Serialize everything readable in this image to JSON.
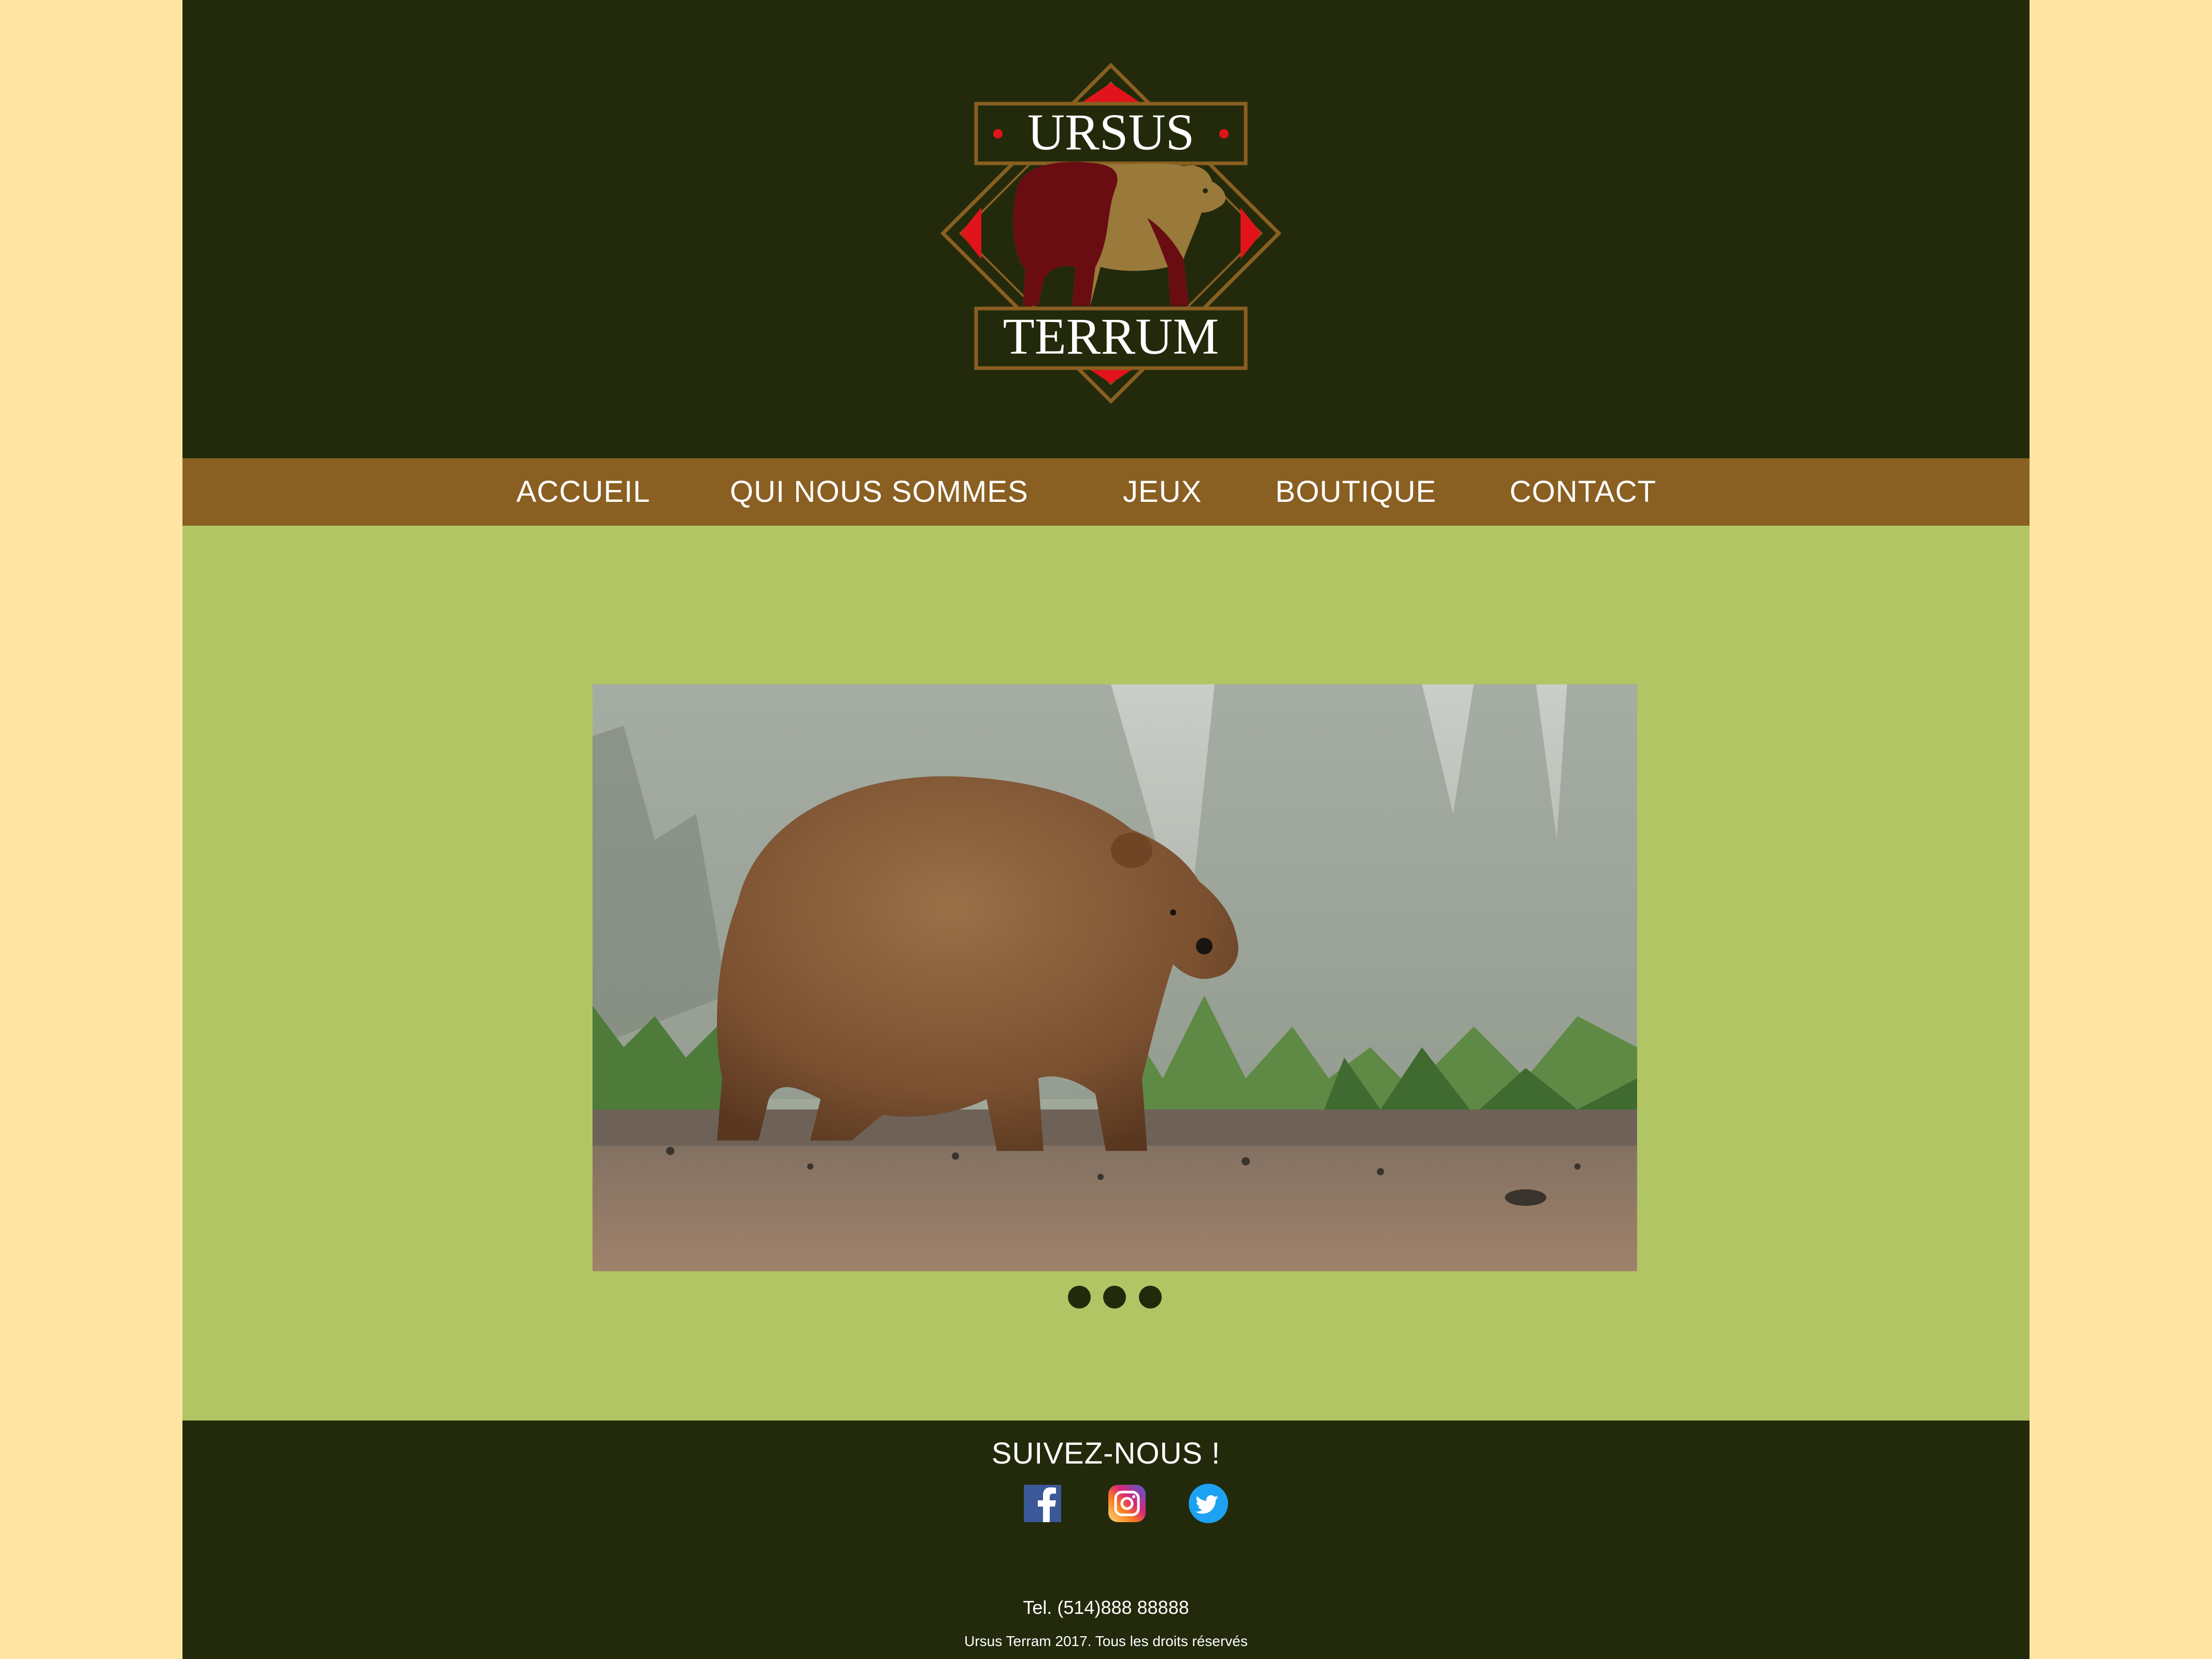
{
  "brand": {
    "logo_top_text": "URSUS",
    "logo_bottom_text": "TERRUM",
    "colors": {
      "dark": "#222a0b",
      "nav": "#8a5f22",
      "main": "#b2c565",
      "outer": "#ffe4a3",
      "accent_red": "#e0141a"
    }
  },
  "nav": {
    "items": [
      {
        "label": "ACCUEIL"
      },
      {
        "label": "QUI NOUS SOMMES"
      },
      {
        "label": "JEUX"
      },
      {
        "label": "BOUTIQUE"
      },
      {
        "label": "CONTACT"
      }
    ]
  },
  "slider": {
    "image": "grizzly-bear-photo",
    "dots": 3
  },
  "footer": {
    "follow_label": "SUIVEZ-NOUS !",
    "social": [
      {
        "name": "facebook-icon"
      },
      {
        "name": "instagram-icon"
      },
      {
        "name": "twitter-icon"
      }
    ],
    "tel": "Tel. (514)888 88888",
    "copyright": "Ursus Terram 2017. Tous les droits réservés"
  }
}
